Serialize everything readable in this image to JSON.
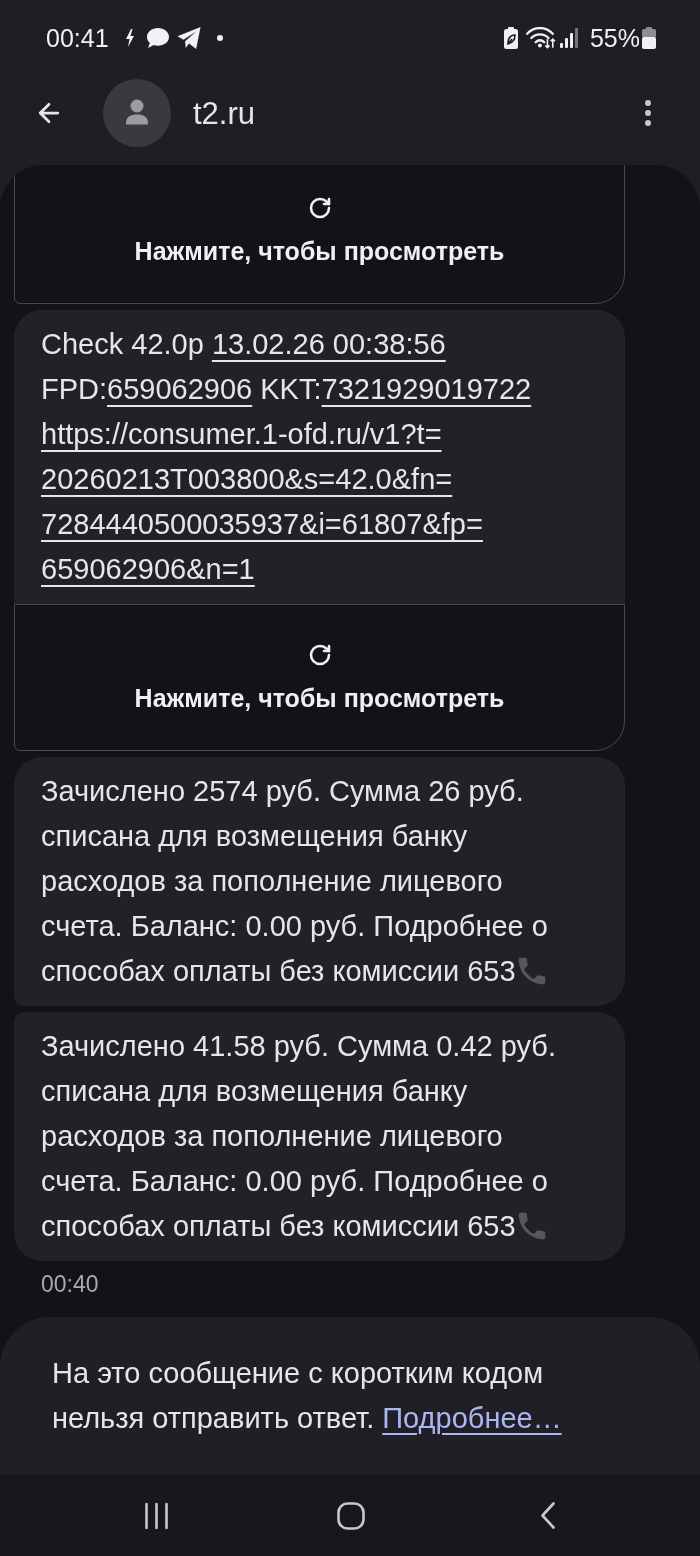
{
  "status_bar": {
    "time": "00:41",
    "battery": "55%"
  },
  "header": {
    "title": "t2.ru"
  },
  "messages": [
    {
      "kind": "mms",
      "label": "Нажмите, чтобы просмотреть"
    },
    {
      "kind": "text",
      "end_icon": false,
      "lines": [
        [
          {
            "kind": "text",
            "text": "Check 42.0р "
          },
          {
            "kind": "link",
            "text": "13.02.26 00:38:56"
          }
        ],
        [
          {
            "kind": "text",
            "text": "FPD:"
          },
          {
            "kind": "link",
            "text": "659062906"
          },
          {
            "kind": "text",
            "text": " KKT:"
          },
          {
            "kind": "link",
            "text": "7321929019722"
          }
        ],
        [
          {
            "kind": "link",
            "text": "https://consumer.1-ofd.ru/v1?t="
          }
        ],
        [
          {
            "kind": "link",
            "text": "20260213T003800&s=42.0&fn="
          }
        ],
        [
          {
            "kind": "link",
            "text": "7284440500035937&i=61807&fp="
          }
        ],
        [
          {
            "kind": "link",
            "text": "659062906&n=1"
          }
        ]
      ]
    },
    {
      "kind": "mms",
      "label": "Нажмите, чтобы просмотреть"
    },
    {
      "kind": "text",
      "end_icon": true,
      "lines": [
        [
          {
            "kind": "text",
            "text": "Зачислено 2574 руб. Сумма 26 руб."
          }
        ],
        [
          {
            "kind": "text",
            "text": "списана для возмещения банку"
          }
        ],
        [
          {
            "kind": "text",
            "text": "расходов за пополнение лицевого"
          }
        ],
        [
          {
            "kind": "text",
            "text": "счета. Баланс: 0.00 руб. Подробнее о"
          }
        ],
        [
          {
            "kind": "text",
            "text": "способах оплаты без комиссии 653"
          }
        ]
      ]
    },
    {
      "kind": "text",
      "end_icon": true,
      "lines": [
        [
          {
            "kind": "text",
            "text": "Зачислено 41.58 руб. Сумма 0.42 руб."
          }
        ],
        [
          {
            "kind": "text",
            "text": "списана для возмещения банку"
          }
        ],
        [
          {
            "kind": "text",
            "text": "расходов за пополнение лицевого"
          }
        ],
        [
          {
            "kind": "text",
            "text": "счета. Баланс: 0.00 руб. Подробнее о"
          }
        ],
        [
          {
            "kind": "text",
            "text": "способах оплаты без комиссии 653"
          }
        ]
      ]
    }
  ],
  "timestamp": "00:40",
  "notice": {
    "lines": [
      "На это сообщение с коротким кодом",
      "нельзя отправить ответ."
    ],
    "link": "Подробнее…"
  }
}
